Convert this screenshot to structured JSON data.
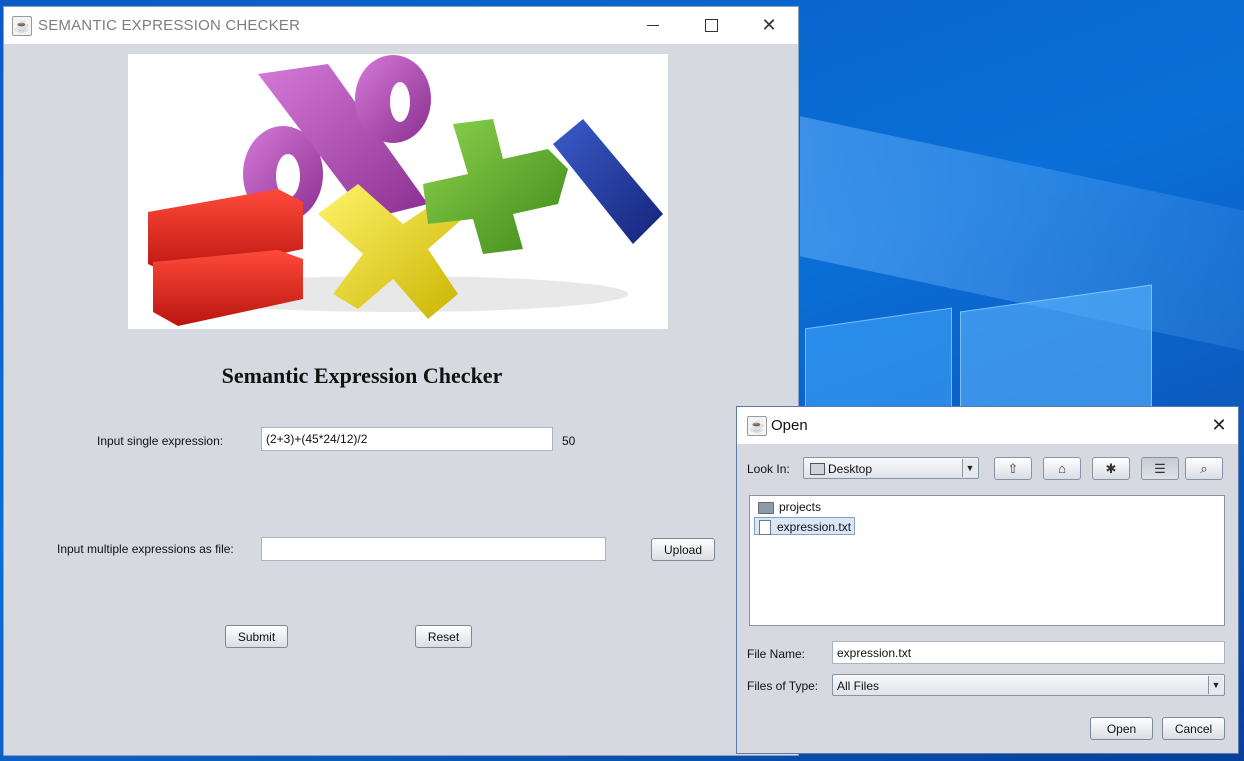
{
  "main_window": {
    "title": "SEMANTIC EXPRESSION CHECKER",
    "heading": "Semantic Expression Checker",
    "single_label": "Input single expression:",
    "single_value": "(2+3)+(45*24/12)/2",
    "single_result": "50",
    "multi_label": "Input multiple expressions as file:",
    "multi_value": "",
    "upload_label": "Upload",
    "submit_label": "Submit",
    "reset_label": "Reset",
    "banner_symbols": [
      "=",
      "%",
      "×",
      "+",
      "/"
    ]
  },
  "open_dialog": {
    "title": "Open",
    "look_in_label": "Look In:",
    "look_in_value": "Desktop",
    "files": [
      {
        "name": "projects",
        "type": "folder",
        "selected": false
      },
      {
        "name": "expression.txt",
        "type": "file",
        "selected": true
      }
    ],
    "file_name_label": "File Name:",
    "file_name_value": "expression.txt",
    "files_of_type_label": "Files of Type:",
    "files_of_type_value": "All Files",
    "open_label": "Open",
    "cancel_label": "Cancel",
    "toolbar_icons": [
      "up-one-level-icon",
      "home-icon",
      "new-folder-icon",
      "list-view-icon",
      "details-view-icon"
    ]
  },
  "colors": {
    "window_bg": "#d6d9df",
    "desktop_blue": "#0a6fd8",
    "selection_bg": "#dbe6f4"
  }
}
